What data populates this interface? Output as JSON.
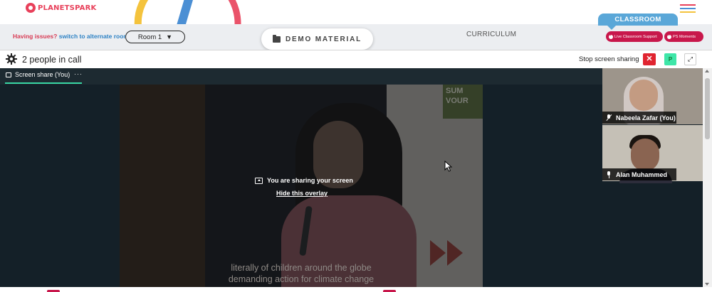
{
  "brand": {
    "logo_text": "PLANETSPARK",
    "accent": "#e8405a"
  },
  "header": {
    "classroom_tab": "CLASSROOM",
    "menu_icon": "hamburger-icon"
  },
  "controls": {
    "issue_prefix": "Having issues?",
    "issue_link": "switch to alternate room",
    "room_select_value": "Room 1",
    "demo_material_label": "DEMO MATERIAL",
    "curriculum_label": "CURRICULUM",
    "live_support_label": "Live Classroom Support",
    "ps_moments_label": "PS Moments"
  },
  "call": {
    "people_count_text": "2 people in call",
    "stop_sharing_label": "Stop screen sharing",
    "close_symbol": "✕",
    "p_button_label": "P",
    "expand_symbol": "⤢",
    "share_tab_label": "Screen share (You)",
    "share_tab_menu": "···",
    "sharing_message": "You are sharing your screen",
    "hide_overlay_label": "Hide this overlay"
  },
  "video": {
    "sign_lines": [
      "SUM",
      "VOUR"
    ],
    "caption_line1": "literally of children around the globe",
    "caption_line2": "demanding action for climate change"
  },
  "participants": [
    {
      "name": "Nabeela Zafar (You)",
      "mic": "muted"
    },
    {
      "name": "Alan Muhammed",
      "mic": "on"
    }
  ],
  "colors": {
    "danger": "#e02430",
    "success": "#3ee6a8",
    "classroom_blue": "#5aa7d8",
    "pill_red": "#c8174b",
    "call_bg": "#142028"
  }
}
